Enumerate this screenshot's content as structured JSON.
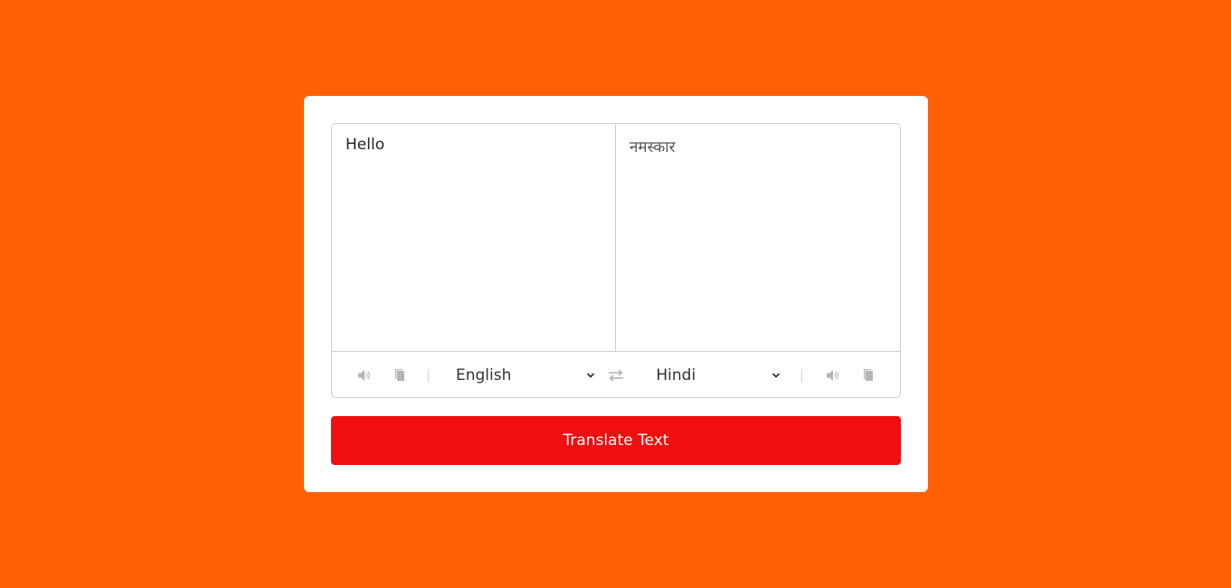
{
  "translator": {
    "from_text": "Hello",
    "to_text": "नमस्कार",
    "from_language": "English",
    "to_language": "Hindi",
    "translate_button_label": "Translate Text"
  },
  "colors": {
    "background": "#ff6005",
    "card": "#ffffff",
    "button": "#f00e0e",
    "icon": "#b5b5b5",
    "border": "#cfcfcf"
  },
  "icons": {
    "from_speak": "volume-icon",
    "from_copy": "copy-icon",
    "exchange": "exchange-icon",
    "to_speak": "volume-icon",
    "to_copy": "copy-icon",
    "dropdown": "chevron-down-icon"
  }
}
